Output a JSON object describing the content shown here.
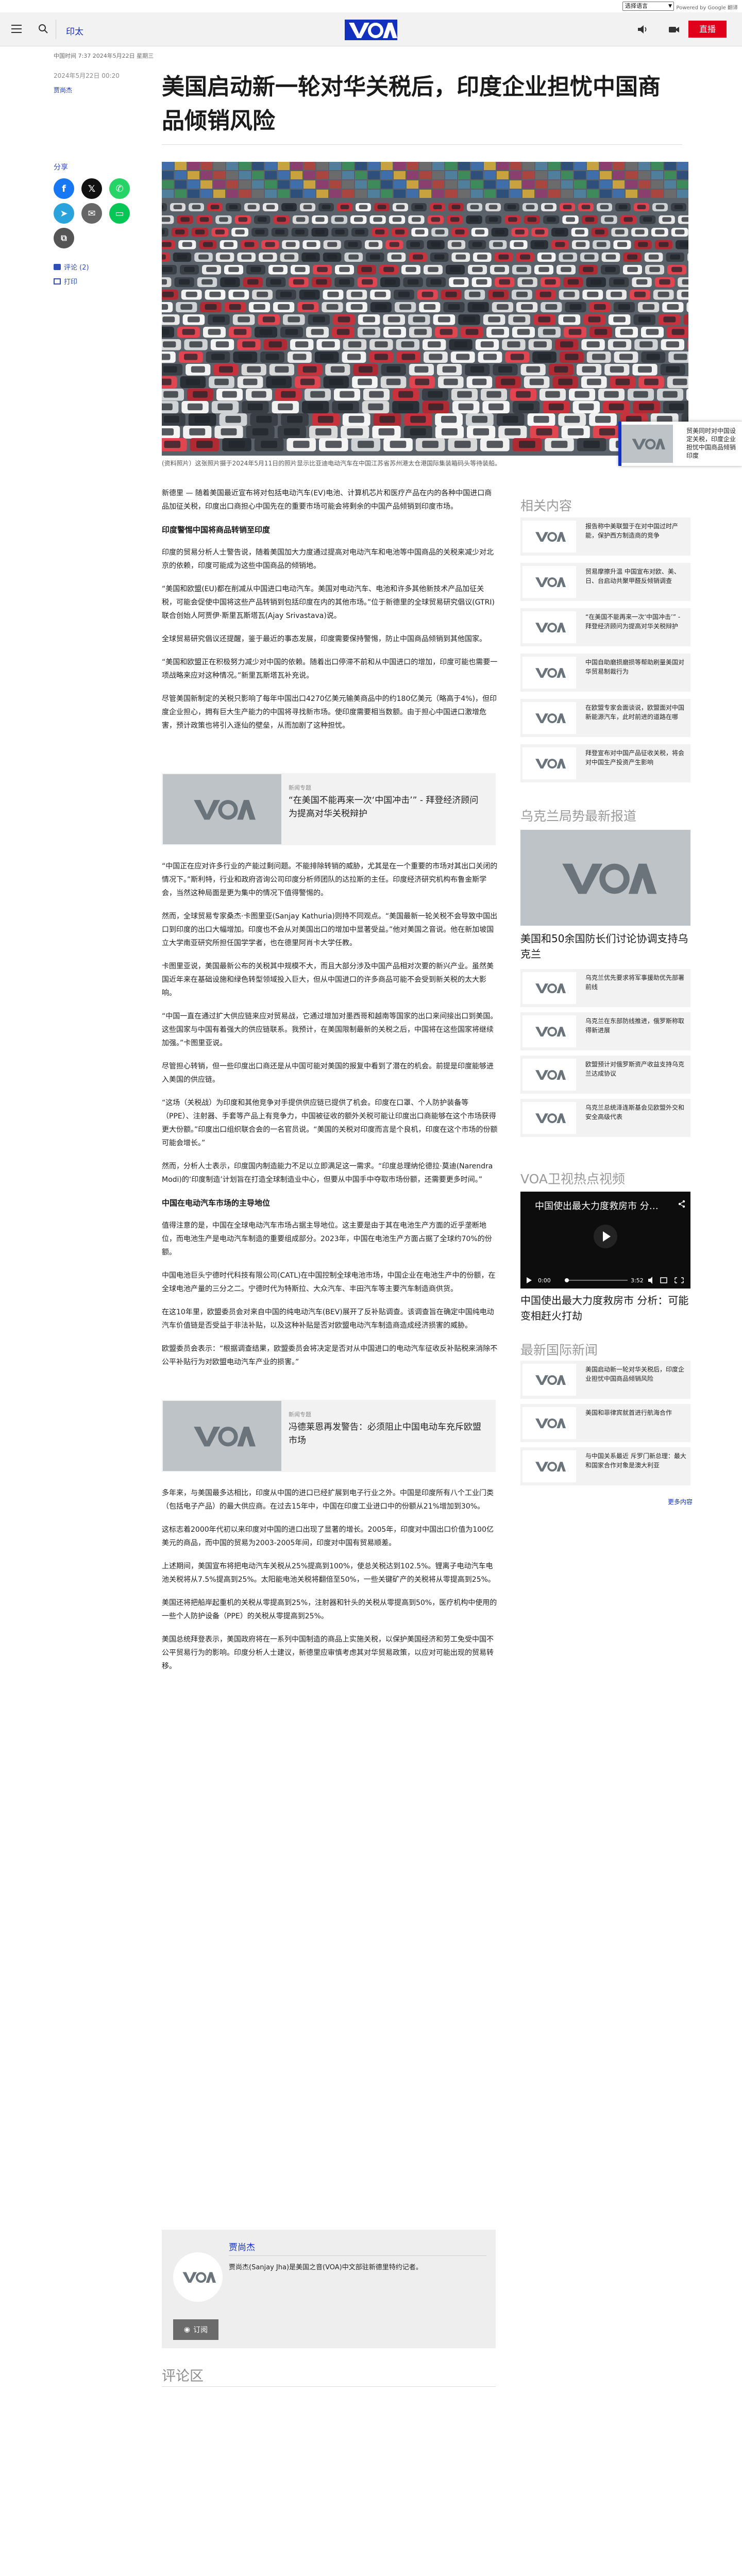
{
  "translate": {
    "select_label": "选择语言",
    "powered": "Powered by Google 翻译"
  },
  "header": {
    "section": "印太",
    "live_label": "直播",
    "brand_colors": {
      "primary": "#1330bf",
      "live": "#e0001b"
    }
  },
  "meta": {
    "breadcrumb": "中国时间 7:37 2024年5月22日 星期三",
    "date": "2024年5月22日 00:20",
    "author": "贾尚杰"
  },
  "article": {
    "title": "美国启动新一轮对华关税后，印度企业担忧中国商品倾销风险",
    "share_label": "分享",
    "comments_link": "评论 (2)",
    "print_link": "打印",
    "caption": "(资料照片）这张照片摄于2024年5月11日的照片显示比亚迪电动汽车在中国江苏省苏州港太仓港国际集装箱码头等待装船。",
    "paragraphs_a": [
      "新德里 — 随着美国最近宣布将对包括电动汽车(EV)电池、计算机芯片和医疗产品在内的各种中国进口商品加征关税，印度出口商担心中国先在的重要市场可能会将剩余的中国产品倾销到印度市场。",
      "印度警惕中国将商品转销至印度",
      "印度的贸易分析人士警告说，随着美国加大力度通过提高对电动汽车和电池等中国商品的关税来减少对北京的依赖，印度可能成为这些中国商品的倾销地。",
      "“美国和欧盟(EU)都在削减从中国进口电动汽车。美国对电动汽车、电池和许多其他新技术产品加征关税，可能会促使中国将这些产品转销到包括印度在内的其他市场。”位于新德里的全球贸易研究倡议(GTRI)联合创始人阿贾伊·斯里瓦斯塔瓦(Ajay Srivastava)说。",
      "全球贸易研究倡议还提醒，鉴于最近的事态发展，印度需要保持警惕，防止中国商品倾销到其他国家。",
      "“美国和欧盟正在积极努力减少对中国的依赖。随着出口停滞不前和从中国进口的增加，印度可能也需要一项战略来应对这种情况。”新里瓦斯塔瓦补充说。",
      "尽管美国新制定的关税只影响了每年中国出口4270亿美元输美商品中的约180亿美元（略高于4%)，但印度企业担心，拥有巨大生产能力的中国将寻找新市场。使印度需要相当数额。由于担心中国进口激增危害，预计政策也将引入逐仙的壁垒，从而加剧了这种担忧。"
    ],
    "related_1": {
      "kicker": "新闻专题",
      "title": "“在美国不能再来一次‘中国冲击’” - 拜登经济顾问为提高对华关税辩护"
    },
    "paragraphs_b": [
      "“中国正在应对许多行业的产能过剩问题。不能排除转销的威胁，尤其是在一个重要的市场对其出口关闭的情况下。”斯利特，行业和政府咨询公司印度分析师团队的达拉斯的主任。印度经济研究机构布鲁金斯学会，当然这种局面是更为集中的情况下值得警惕的。",
      "然而，全球贸易专家桑杰·卡图里亚(Sanjay Kathuria)则持不同观点。“美国最新一轮关税不会导致中国出口到印度的出口大幅增加。印度也不会从对美国出口的增加中显著受益。”他对美国之音说。他在新加坡国立大学南亚研究所担任国学学者，也在德里阿肖卡大学任教。",
      "卡图里亚说，美国最新公布的关税其中规模不大，而且大部分涉及中国产品相对次要的新兴产业。虽然美国近年来在基础设施和绿色转型领域投入巨大，但从中国进口的许多商品可能不会受到新关税的太大影响。",
      "“中国一直在通过扩大供应链来应对贸易战，它通过增加对墨西哥和越南等国家的出口来间接出口到美国。这些国家与中国有着强大的供应链联系。我预计，在美国限制最新的关税之后，中国将在这些国家将继续加强。”卡图里亚说。",
      "尽管担心转销，但一些印度出口商还是从中国可能对美国的报复中看到了潜在的机会。前提是印度能够进入美国的供应链。",
      "“这场（关税战）为印度和其他竞争对手提供供应链已提供了机会。印度在口罩、个人防护装备等（PPE）、注射器、手套等产品上有竞争力，中国被征收的额外关税可能让印度出口商能够在这个市场获得更大份额。”印度出口组织联合会的一名官员说。“美国的关税对印度而言是个良机，印度在这个市场的份额可能会增长。”",
      "然而，分析人士表示，印度国内制造能力不足以立即满足这一需求。“印度总理纳伦德拉·莫迪(Narendra Modi)的‘印度制造’计划旨在打造全球制造业中心，但要从中国手中夺取市场份额，还需要更多时间。”"
    ],
    "heading_2": "中国在电动汽车市场的主导地位",
    "paragraphs_c": [
      "值得注意的是，中国在全球电动汽车市场占据主导地位。这主要是由于其在电池生产方面的近乎垄断地位，而电池生产是电动汽车制造的重要组成部分。2023年，中国在电池生产方面占据了全球约70%的份额。",
      "中国电池巨头宁德时代科技有限公司(CATL)在中国控制全球电池市场，中国企业在电池生产中的份额，在全球电池产量的三分之二。宁德时代为特斯拉、大众汽车、丰田汽车等主要汽车制造商供货。",
      "在这10年里，欧盟委员会对来自中国的纯电动汽车(BEV)展开了反补贴调查。该调查旨在确定中国纯电动汽车价值链是否受益于非法补贴，以及这种补贴是否对欧盟电动汽车制造商造成经济损害的威胁。",
      "欧盟委员会表示：“根据调查结果，欧盟委员会将决定是否对从中国进口的电动汽车征收反补贴税来消除不公平补贴行为对欧盟电动汽车产业的损害。”"
    ],
    "related_2": {
      "kicker": "新闻专题",
      "title": "冯德莱恩再发警告：必须阻止中国电动车充斥欧盟市场"
    },
    "paragraphs_d": [
      "多年来，与美国最多达相比，印度从中国的进口已经扩展到电子行业之外。中国是印度所有八个工业门类（包括电子产品）的最大供应商。在过去15年中，中国在印度工业进口中的份额从21%增加到30%。",
      "这标志着2000年代初以来印度对中国的进口出现了显著的增长。2005年，印度对中国出口价值为100亿美元的商品，而中国的贸易为2003-2005年间，印度对中国有贸易顺差。",
      "上述期间，美国宣布将把电动汽车关税从25%提高到100%，使总关税达到102.5%。锂离子电动汽车电池关税将从7.5%提高到25%。太阳能电池关税将翻倍至50%，一些关键矿产的关税将从零提高到25%。",
      "美国还将把船岸起重机的关税从零提高到25%，注射器和针头的关税从零提高到50%，医疗机构中使用的一些个人防护设备（PPE）的关税从零提高到25%。",
      "美国总统拜登表示，美国政府将在一系列中国制造的商品上实施关税，以保护美国经济和劳工免受中国不公平贸易行为的影响。印度分析人士建议，新德里应审慎考虑其对华贸易政策，以应对可能出现的贸易转移。"
    ]
  },
  "author_box": {
    "name": "贾尚杰",
    "bio": "贾尚杰(Sanjay Jha)是美国之音(VOA)中文部驻新德里特约记者。",
    "subscribe": "订阅"
  },
  "comments": {
    "title": "评论区"
  },
  "sidebar": {
    "related_title": "相关内容",
    "related": [
      "报告称中美联盟于在对中国过时产能，保护西方制造商的竞争",
      "贸易摩擦升温 中国宣布对欧、美、日、台启动共聚甲醛反倾销调查",
      "“在美国不能再来一次‘中国冲击’” - 拜登经济顾问为提高对华关税辩护",
      "中国自助磨损磨损等帮助刷量美国对华贸易制裁行为",
      "在欧盟专家会面谈说，欧盟面对中国新能源汽车，此时前进的道路在哪",
      "拜登宣布对中国产品征收关税，将会对中国生产投资产生影响"
    ],
    "ukraine_title": "乌克兰局势最新报道",
    "ukraine_lead": "美国和50余国防长们讨论协调支持乌克兰",
    "ukraine": [
      "乌克兰优先要求将军事援助优先部署前线",
      "乌克兰在东部防线推进，俄罗斯称取得新进展",
      "欧盟预计对俄罗斯资产收益支持乌克兰达成协议",
      "乌克兰总统泽连斯基会见欧盟外交和安全高级代表"
    ],
    "video_title": "VOA卫视热点视频",
    "video_overlay": "中国使出最大力度救房市 分…",
    "video_time": "0:00",
    "video_duration": "3:52",
    "video_caption": "中国使出最大力度救房市 分析：可能变相赶火打劫",
    "intl_title": "最新国际新闻",
    "intl": [
      "美国启动新一轮对华关税后，印度企业担忧中国商品倾销风险",
      "美国和菲律宾就首进行航海合作",
      "与中国关系最近 斥罗门新总理：最大和国家合作对象是澳大利亚"
    ],
    "more_link": "更多内容"
  },
  "floating": {
    "text": "贸美同时对中国设定关税，印度企业担忧中国商品倾销印度"
  }
}
